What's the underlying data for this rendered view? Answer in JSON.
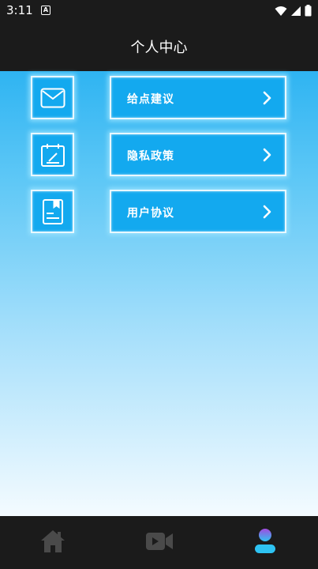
{
  "status": {
    "time": "3:11",
    "notification_letter": "A"
  },
  "header": {
    "title": "个人中心"
  },
  "menu": {
    "items": [
      {
        "label": "给点建议",
        "icon": "mail-icon"
      },
      {
        "label": "隐私政策",
        "icon": "calendar-edit-icon"
      },
      {
        "label": "用户协议",
        "icon": "document-icon"
      }
    ]
  },
  "tabbar": {
    "tabs": [
      {
        "icon": "home-icon",
        "active": false
      },
      {
        "icon": "video-camera-icon",
        "active": false
      },
      {
        "icon": "user-icon",
        "active": true
      }
    ]
  },
  "colors": {
    "bar_background": "#1b1b1b",
    "button_fill": "#13a9ef",
    "glow_border": "#e8f8ff",
    "active_tab_top": "#a24bdf",
    "active_tab_bottom": "#2ec3f3",
    "inactive_tab": "#4a4a4a"
  }
}
